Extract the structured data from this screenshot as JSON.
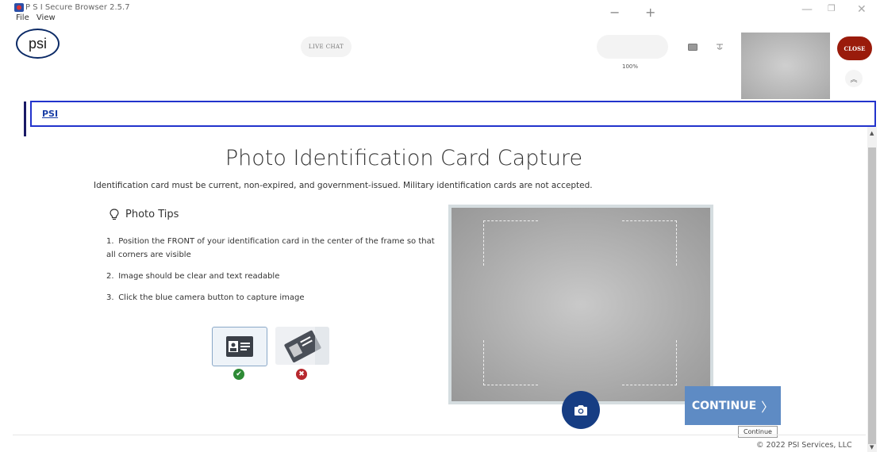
{
  "window": {
    "title": "P S I Secure Browser 2.5.7",
    "menu": [
      "File",
      "View"
    ],
    "controls": {
      "minimize": "—",
      "restore": "❐",
      "close": "✕"
    }
  },
  "toolbar": {
    "logo": "psi",
    "live_chat": "LIVE CHAT",
    "zoom_out": "−",
    "zoom_in": "+",
    "zoom_level": "100%",
    "close": "CLOSE",
    "collapse_icon": "chevrons-up-icon"
  },
  "tabbar": {
    "tab": "PSI"
  },
  "page": {
    "title": "Photo Identification Card Capture",
    "subtitle": "Identification card must be current, non-expired, and government-issued. Military identification cards are not accepted.",
    "tips_heading": "Photo Tips",
    "tips": [
      {
        "num": "1.",
        "text": "Position the FRONT of your identification card in the center of the frame so that all corners are visible"
      },
      {
        "num": "2.",
        "text": "Image should be clear and text readable"
      },
      {
        "num": "3.",
        "text": "Click the blue camera button to capture image"
      }
    ],
    "continue": "CONTINUE",
    "tooltip": "Continue",
    "copyright": "© 2022 PSI Services, LLC"
  },
  "colors": {
    "close": "#9a1b0b",
    "camera": "#163d83",
    "continue": "#5e8bc4",
    "tab_border": "#2233cc",
    "ok": "#2e8b36",
    "error": "#b7282e"
  }
}
